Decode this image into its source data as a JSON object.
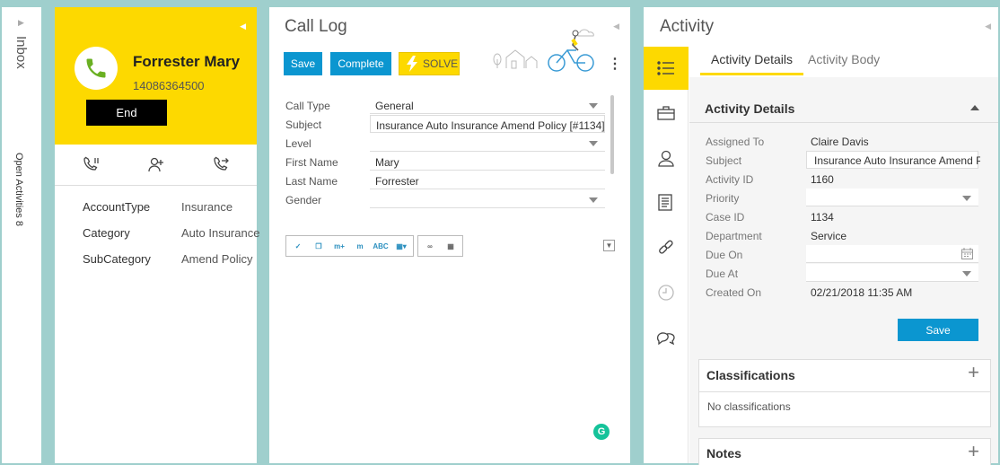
{
  "inbox": {
    "title": "Inbox",
    "open_activities": "Open Activities 8"
  },
  "caller": {
    "name": "Forrester Mary",
    "phone": "14086364500",
    "end_label": "End",
    "fields": [
      {
        "label": "AccountType",
        "value": "Insurance"
      },
      {
        "label": "Category",
        "value": "Auto Insurance"
      },
      {
        "label": "SubCategory",
        "value": "Amend Policy"
      }
    ],
    "colors": {
      "accent": "#fdd900",
      "end_button": "#000000"
    }
  },
  "call_log": {
    "title": "Call Log",
    "save_label": "Save",
    "complete_label": "Complete",
    "solve_label": "SOLVE",
    "fields": [
      {
        "label": "Call Type",
        "value": "General"
      },
      {
        "label": "Subject",
        "value": "Insurance Auto Insurance Amend Policy [#1134]"
      },
      {
        "label": "Level",
        "value": ""
      },
      {
        "label": "First Name",
        "value": "Mary"
      },
      {
        "label": "Last Name",
        "value": "Forrester"
      },
      {
        "label": "Gender",
        "value": ""
      }
    ],
    "toolbar_icons": [
      "clear-format-icon",
      "copy-icon",
      "merge-field-add-icon",
      "merge-field-icon",
      "spellcheck-icon",
      "paste-icon",
      "link-icon",
      "table-icon"
    ],
    "grammarly_badge": "G",
    "colors": {
      "button": "#0b96d0",
      "solve": "#fdd900"
    }
  },
  "activity": {
    "title": "Activity",
    "tabs": [
      {
        "label": "Activity Details",
        "active": true
      },
      {
        "label": "Activity Body",
        "active": false
      }
    ],
    "rail_icons": [
      "list-icon",
      "briefcase-icon",
      "contact-icon",
      "notes-icon",
      "link-icon",
      "history-icon",
      "chat-icon"
    ],
    "details": {
      "title": "Activity Details",
      "rows": [
        {
          "label": "Assigned To",
          "value": "Claire Davis"
        },
        {
          "label": "Subject",
          "value": "Insurance Auto Insurance Amend P"
        },
        {
          "label": "Activity ID",
          "value": "1160"
        },
        {
          "label": "Priority",
          "value": ""
        },
        {
          "label": "Case ID",
          "value": "1134"
        },
        {
          "label": "Department",
          "value": "Service"
        },
        {
          "label": "Due On",
          "value": ""
        },
        {
          "label": "Due At",
          "value": ""
        },
        {
          "label": "Created On",
          "value": "02/21/2018 11:35 AM"
        }
      ],
      "save_label": "Save"
    },
    "classifications": {
      "title": "Classifications",
      "empty_text": "No classifications"
    },
    "notes": {
      "title": "Notes"
    }
  }
}
